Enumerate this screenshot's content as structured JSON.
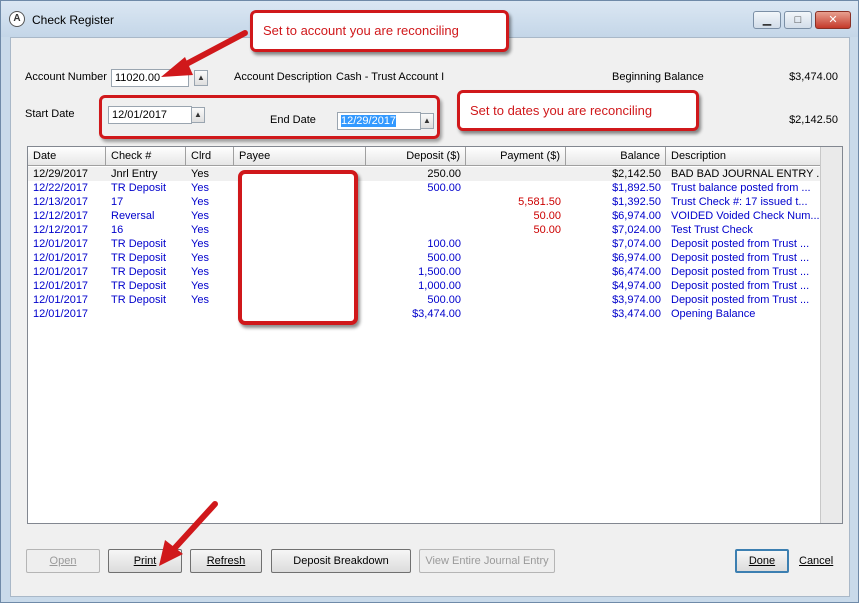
{
  "window": {
    "title": "Check Register",
    "controls": {
      "minimize": "▁",
      "maximize": "□",
      "close": "✕"
    },
    "app_icon": "logo-icon"
  },
  "header": {
    "account_number_label": "Account Number",
    "account_number_value": "11020.00",
    "account_description_label": "Account Description",
    "account_description_value": "Cash - Trust Account I",
    "beginning_balance_label": "Beginning Balance",
    "beginning_balance_value": "$3,474.00",
    "start_date_label": "Start Date",
    "start_date_value": "12/01/2017",
    "end_date_label": "End Date",
    "end_date_value": "12/29/2017",
    "ending_balance_value": "$2,142.50"
  },
  "grid": {
    "columns": [
      "Date",
      "Check #",
      "Clrd",
      "Payee",
      "Deposit ($)",
      "Payment ($)",
      "Balance",
      "Description"
    ],
    "rows": [
      {
        "date": "12/29/2017",
        "check": "Jnrl Entry",
        "clrd": "Yes",
        "payee": "",
        "deposit": "250.00",
        "payment": "",
        "balance": "$2,142.50",
        "description": "BAD BAD JOURNAL ENTRY ...",
        "color": "black"
      },
      {
        "date": "12/22/2017",
        "check": "TR Deposit",
        "clrd": "Yes",
        "payee": "",
        "deposit": "500.00",
        "payment": "",
        "balance": "$1,892.50",
        "description": "Trust balance posted from ...",
        "color": "blue"
      },
      {
        "date": "12/13/2017",
        "check": "17",
        "clrd": "Yes",
        "payee": "",
        "deposit": "",
        "payment": "5,581.50",
        "balance": "$1,392.50",
        "description": "Trust Check #: 17 issued t...",
        "color": "blue"
      },
      {
        "date": "12/12/2017",
        "check": "Reversal",
        "clrd": "Yes",
        "payee": "",
        "deposit": "",
        "payment": "50.00",
        "balance": "$6,974.00",
        "description": "VOIDED Voided Check Num...",
        "color": "blue"
      },
      {
        "date": "12/12/2017",
        "check": "16",
        "clrd": "Yes",
        "payee": "",
        "deposit": "",
        "payment": "50.00",
        "balance": "$7,024.00",
        "description": "Test Trust Check",
        "color": "blue"
      },
      {
        "date": "12/01/2017",
        "check": "TR Deposit",
        "clrd": "Yes",
        "payee": "",
        "deposit": "100.00",
        "payment": "",
        "balance": "$7,074.00",
        "description": "Deposit posted from Trust ...",
        "color": "blue"
      },
      {
        "date": "12/01/2017",
        "check": "TR Deposit",
        "clrd": "Yes",
        "payee": "",
        "deposit": "500.00",
        "payment": "",
        "balance": "$6,974.00",
        "description": "Deposit posted from Trust ...",
        "color": "blue"
      },
      {
        "date": "12/01/2017",
        "check": "TR Deposit",
        "clrd": "Yes",
        "payee": "",
        "deposit": "1,500.00",
        "payment": "",
        "balance": "$6,474.00",
        "description": "Deposit posted from Trust ...",
        "color": "blue"
      },
      {
        "date": "12/01/2017",
        "check": "TR Deposit",
        "clrd": "Yes",
        "payee": "",
        "deposit": "1,000.00",
        "payment": "",
        "balance": "$4,974.00",
        "description": "Deposit posted from Trust ...",
        "color": "blue"
      },
      {
        "date": "12/01/2017",
        "check": "TR Deposit",
        "clrd": "Yes",
        "payee": "",
        "deposit": "500.00",
        "payment": "",
        "balance": "$3,974.00",
        "description": "Deposit posted from Trust ...",
        "color": "blue"
      },
      {
        "date": "12/01/2017",
        "check": "",
        "clrd": "",
        "payee": "",
        "deposit": "$3,474.00",
        "payment": "",
        "balance": "$3,474.00",
        "description": "Opening Balance",
        "color": "blue"
      }
    ]
  },
  "buttons": {
    "open": "Open",
    "print": "Print",
    "refresh": "Refresh",
    "deposit_breakdown": "Deposit Breakdown",
    "view_journal": "View Entire Journal Entry",
    "done": "Done",
    "cancel": "Cancel"
  },
  "annotations": {
    "account_callout": "Set to account you are reconciling",
    "dates_callout": "Set to dates you are reconciling"
  },
  "colors": {
    "accent_red": "#d0181b",
    "deposit_blue": "#0000cc",
    "payment_red": "#cc0000",
    "selection": "#3399ff"
  }
}
